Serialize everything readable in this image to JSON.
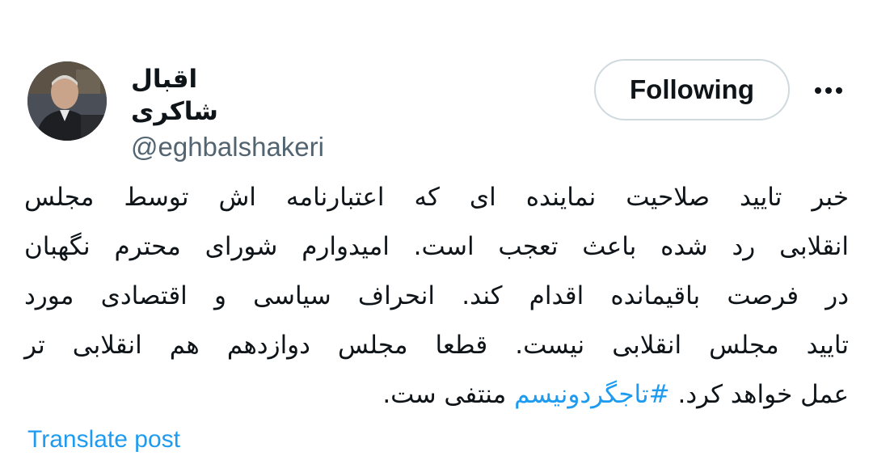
{
  "author": {
    "display_name": "اقبال شاکری",
    "handle": "@eghbalshakeri"
  },
  "actions": {
    "follow_label": "Following",
    "more_icon": "ellipsis-icon"
  },
  "tweet": {
    "lines": [
      "خبر تایید صلاحیت نماینده ای که اعتبارنامه اش توسط مجلس",
      "انقلابی رد شده باعث تعجب است. امیدوارم شورای محترم نگهبان",
      "در فرصت باقیمانده اقدام کند. انحراف سیاسی و اقتصادی مورد",
      "تایید مجلس انقلابی نیست. قطعا مجلس دوازدهم هم انقلابی تر"
    ],
    "last_line_before": "عمل خواهد کرد. ",
    "hashtag": "#تاجگردونیسم",
    "last_line_after": " منتفی ست."
  },
  "footer": {
    "translate_label": "Translate post"
  },
  "colors": {
    "link": "#1d9bf0",
    "text": "#0f1419",
    "secondary": "#536471",
    "border": "#cfd9de"
  }
}
